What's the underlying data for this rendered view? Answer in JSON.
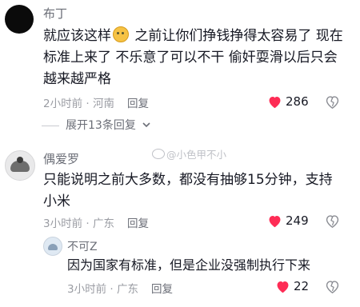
{
  "comments": [
    {
      "username": "布丁",
      "text_part1": "就应该这样",
      "emoji": "doge-emoji",
      "text_part2": " 之前让你们挣钱挣得太容易了 现在标准上来了  不乐意了可以不干 偷奸耍滑以后只会越来越严格",
      "meta": "2小时前 · 河南",
      "reply_label": "回复",
      "likes": "286",
      "liked": true,
      "expand_label": "展开13条回复"
    },
    {
      "username": "偶爱罗",
      "text": "只能说明之前大多数，都没有抽够15分钟，支持小米",
      "meta": "3小时前 · 广东",
      "reply_label": "回复",
      "likes": "249",
      "liked": true
    },
    {
      "username": "不可Z",
      "text": "因为国家有标准，但是企业没强制执行下来",
      "meta": "3小时前 · 广东",
      "reply_label": "回复",
      "likes": "22",
      "liked": true
    }
  ],
  "watermark": "@小色甲不小",
  "colors": {
    "like": "#fe2c55",
    "text": "#161823",
    "meta": "#9a9ca3"
  }
}
